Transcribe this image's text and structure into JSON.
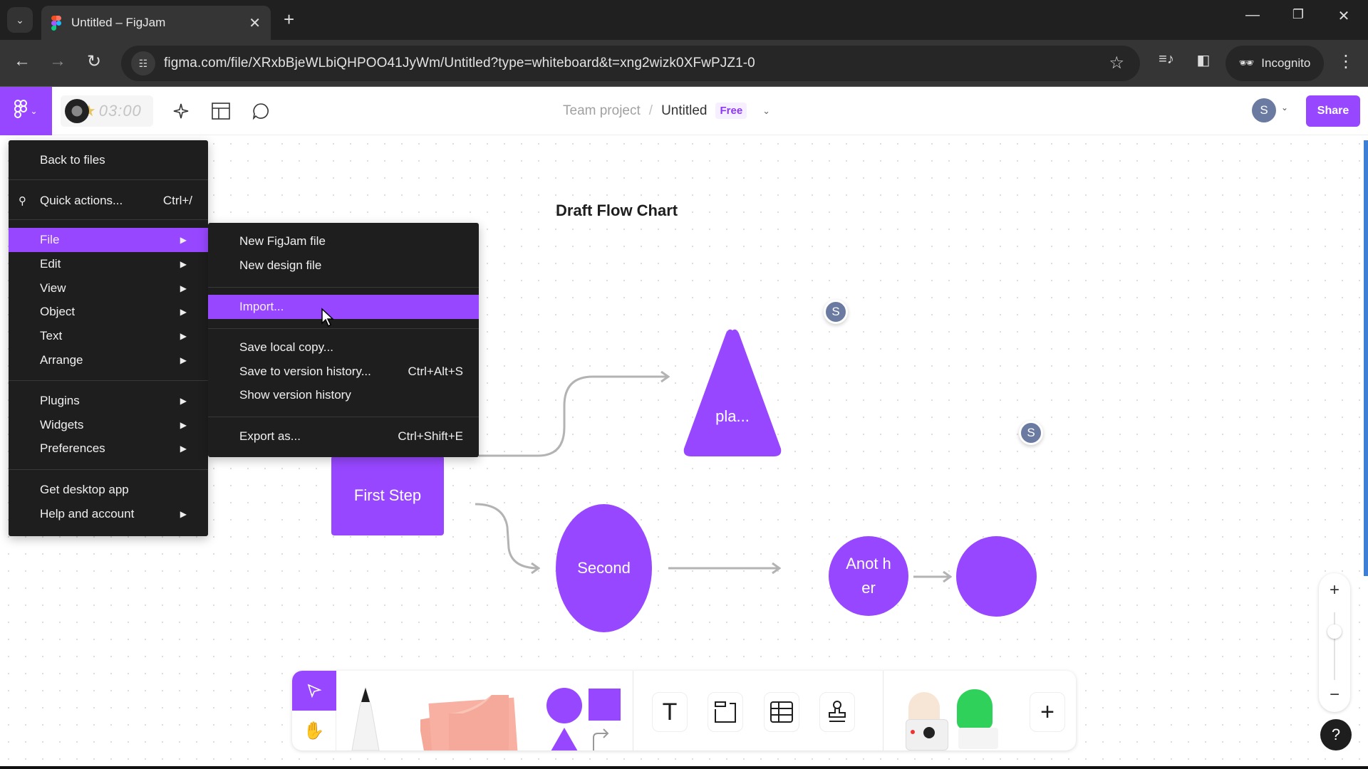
{
  "browser": {
    "tab_title": "Untitled – FigJam",
    "tab_close": "✕",
    "new_tab": "+",
    "url": "figma.com/file/XRxbBjeWLbiQHPOO41JyWm/Untitled?type=whiteboard&t=xng2wizk0XFwPJZ1-0",
    "incognito_label": "Incognito",
    "window_controls": {
      "minimize": "—",
      "restore": "❐",
      "close": "✕"
    },
    "nav": {
      "back": "←",
      "forward": "→",
      "reload": "↻"
    }
  },
  "toolbar": {
    "timer": "03:00",
    "breadcrumb_team": "Team project",
    "breadcrumb_sep": "/",
    "file_title": "Untitled",
    "plan_badge": "Free",
    "user_initial": "S",
    "share_label": "Share"
  },
  "main_menu": {
    "items": [
      {
        "label": "Back to files"
      },
      {
        "label": "Quick actions...",
        "shortcut": "Ctrl+/"
      },
      {
        "label": "File",
        "active": true
      },
      {
        "label": "Edit"
      },
      {
        "label": "View"
      },
      {
        "label": "Object"
      },
      {
        "label": "Text"
      },
      {
        "label": "Arrange"
      },
      {
        "label": "Plugins"
      },
      {
        "label": "Widgets"
      },
      {
        "label": "Preferences"
      },
      {
        "label": "Get desktop app"
      },
      {
        "label": "Help and account"
      }
    ]
  },
  "file_submenu": {
    "items": [
      {
        "label": "New FigJam file"
      },
      {
        "label": "New design file"
      },
      {
        "label": "Import...",
        "hovered": true
      },
      {
        "label": "Save local copy..."
      },
      {
        "label": "Save to version history...",
        "shortcut": "Ctrl+Alt+S"
      },
      {
        "label": "Show version history"
      },
      {
        "label": "Export as...",
        "shortcut": "Ctrl+Shift+E"
      }
    ]
  },
  "canvas": {
    "title": "Draft Flow Chart",
    "shapes": {
      "triangle": "pla...",
      "first_step": "First Step",
      "second": "Second",
      "another": "Anot her",
      "last": ""
    },
    "collaborators": [
      "S",
      "S"
    ]
  },
  "bottom_toolbar": {
    "add_label": "+"
  },
  "zoom": {
    "in": "+",
    "out": "−",
    "help": "?"
  },
  "colors": {
    "accent": "#9747ff",
    "avatar": "#6b7aa1",
    "scrollbar": "#3d7fd6"
  }
}
